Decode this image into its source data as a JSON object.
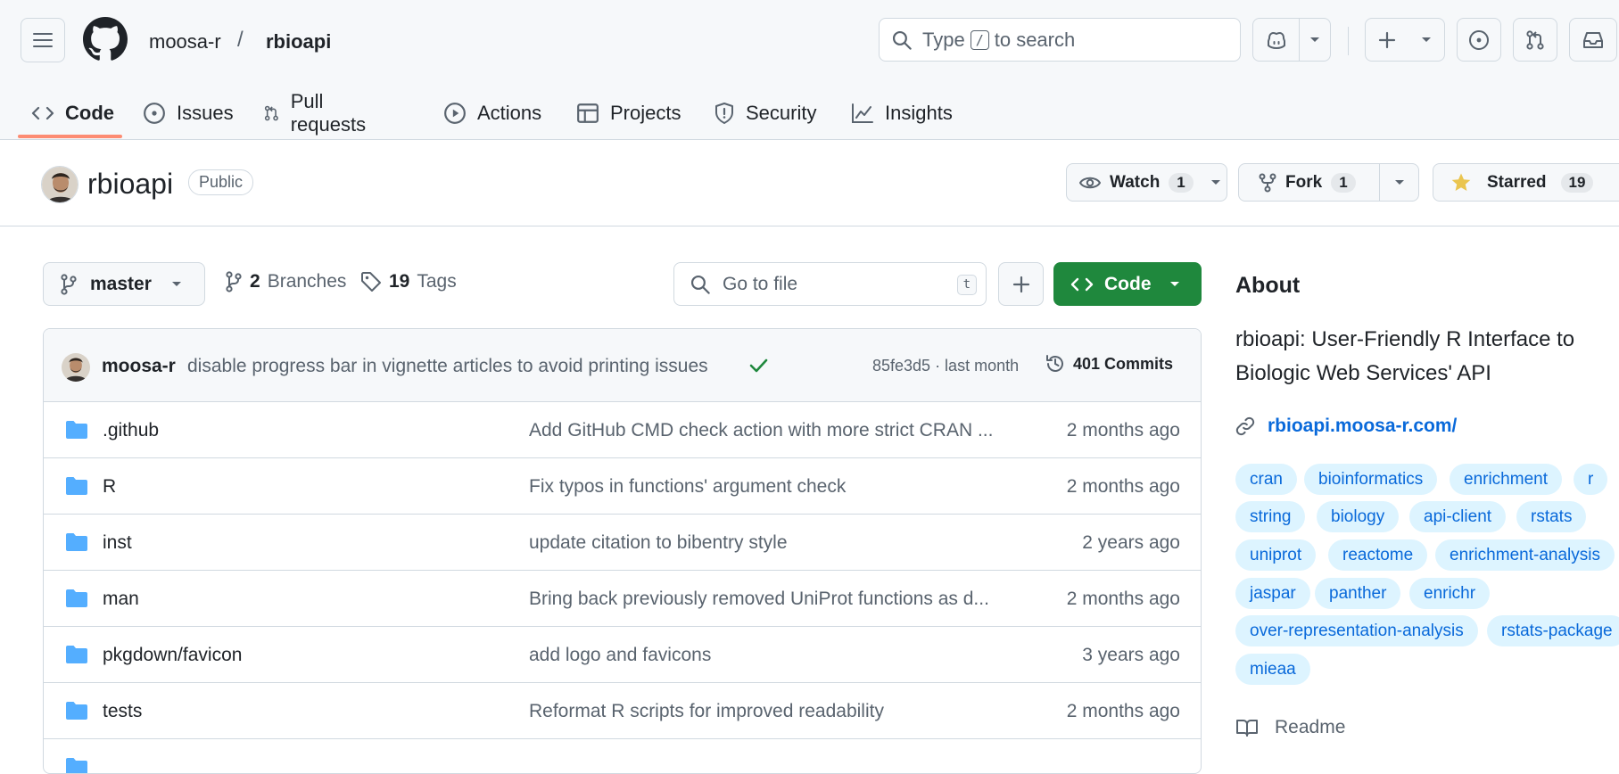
{
  "header": {
    "owner": "moosa-r",
    "separator": "/",
    "repo": "rbioapi",
    "search_prefix": "Type",
    "search_key": "/",
    "search_suffix": "to search"
  },
  "tabs": [
    {
      "label": "Code",
      "icon": "code-icon"
    },
    {
      "label": "Issues",
      "icon": "issue-opened-icon"
    },
    {
      "label": "Pull requests",
      "icon": "git-pull-request-icon"
    },
    {
      "label": "Actions",
      "icon": "play-icon"
    },
    {
      "label": "Projects",
      "icon": "table-icon"
    },
    {
      "label": "Security",
      "icon": "shield-icon"
    },
    {
      "label": "Insights",
      "icon": "graph-icon"
    }
  ],
  "repo": {
    "name": "rbioapi",
    "visibility": "Public",
    "watch_label": "Watch",
    "watch_count": "1",
    "fork_label": "Fork",
    "fork_count": "1",
    "star_label": "Starred",
    "star_count": "19"
  },
  "filenav": {
    "branch": "master",
    "branches_count": "2",
    "branches_label": "Branches",
    "tags_count": "19",
    "tags_label": "Tags",
    "goto_placeholder": "Go to file",
    "goto_key": "t",
    "code_label": "Code"
  },
  "commit": {
    "author": "moosa-r",
    "message": "disable progress bar in vignette articles to avoid printing issues",
    "hash_time": "85fe3d5 · last month",
    "commits_label": "401 Commits"
  },
  "files": [
    {
      "name": ".github",
      "message": "Add GitHub CMD check action with more strict CRAN ...",
      "age": "2 months ago"
    },
    {
      "name": "R",
      "message": "Fix typos in functions' argument check",
      "age": "2 months ago"
    },
    {
      "name": "inst",
      "message": "update citation to bibentry style",
      "age": "2 years ago"
    },
    {
      "name": "man",
      "message": "Bring back previously removed UniProt functions as d...",
      "age": "2 months ago"
    },
    {
      "name": "pkgdown/favicon",
      "message": "add logo and favicons",
      "age": "3 years ago"
    },
    {
      "name": "tests",
      "message": "Reformat R scripts for improved readability",
      "age": "2 months ago"
    }
  ],
  "about": {
    "title": "About",
    "description": "rbioapi: User-Friendly R Interface to Biologic Web Services' API",
    "website": "rbioapi.moosa-r.com/",
    "topics": [
      "cran",
      "bioinformatics",
      "enrichment",
      "r",
      "string",
      "biology",
      "api-client",
      "rstats",
      "uniprot",
      "reactome",
      "enrichment-analysis",
      "jaspar",
      "panther",
      "enrichr",
      "over-representation-analysis",
      "rstats-package",
      "mieaa"
    ],
    "readme_label": "Readme"
  },
  "colors": {
    "accent_green": "#1f883d",
    "link_blue": "#0969da",
    "topic_bg": "#ddf4ff",
    "folder_blue": "#54aeff",
    "tab_underline": "#fd8c73",
    "star_yellow": "#eac54f"
  }
}
